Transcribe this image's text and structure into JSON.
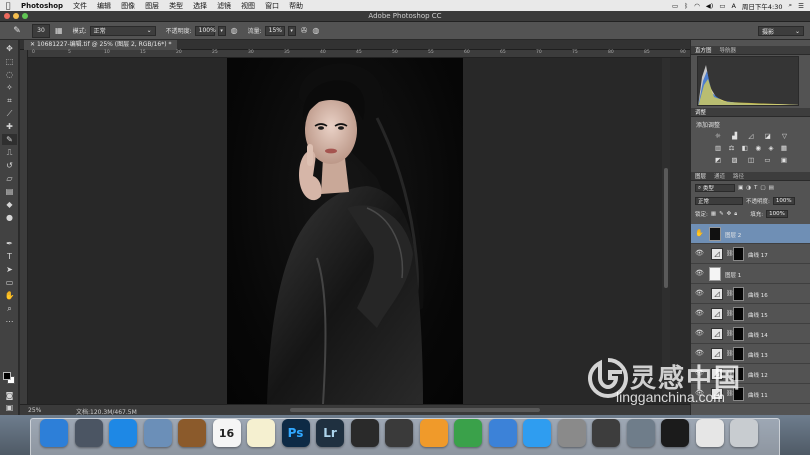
{
  "menubar": {
    "apple": "",
    "items": [
      "Photoshop",
      "文件",
      "编辑",
      "图像",
      "图层",
      "类型",
      "选择",
      "滤镜",
      "视图",
      "窗口",
      "帮助"
    ],
    "clock": "周日下午4:30"
  },
  "window": {
    "title": "Adobe Photoshop CC"
  },
  "options": {
    "mode_label": "模式:",
    "mode_value": "正常",
    "opacity_label": "不透明度:",
    "opacity_value": "100%",
    "flow_label": "流量:",
    "flow_value": "15%",
    "brush_size": "30",
    "workspace": "摄影"
  },
  "document": {
    "tab": "10681227-编辑.tif @ 25% (图层 2, RGB/16*) *",
    "ruler_marks": [
      "0",
      "5",
      "10",
      "15",
      "20",
      "25",
      "30",
      "35",
      "40",
      "45",
      "50",
      "55",
      "60",
      "65",
      "70",
      "75",
      "80",
      "85",
      "90"
    ]
  },
  "status": {
    "zoom": "25%",
    "docinfo": "文档:120.3M/467.5M"
  },
  "panels": {
    "histogram_tabs": [
      "直方图",
      "导航器"
    ],
    "adjustments_tab": "调整",
    "adjustments_title": "添加调整",
    "layers_tabs": [
      "图层",
      "通道",
      "路径"
    ],
    "kind_label": "类型",
    "blend_mode": "正常",
    "opacity_label": "不透明度:",
    "opacity_value": "100%",
    "lock_label": "锁定:",
    "fill_label": "填充:",
    "fill_value": "100%"
  },
  "layers": [
    {
      "name": "图层 2",
      "type": "pixel",
      "selected": true,
      "eye": "hand"
    },
    {
      "name": "曲线 17",
      "type": "curves",
      "selected": false,
      "eye": "eye"
    },
    {
      "name": "图层 1",
      "type": "pixel-white",
      "selected": false,
      "eye": "eye"
    },
    {
      "name": "曲线 16",
      "type": "curves",
      "selected": false,
      "eye": "eye"
    },
    {
      "name": "曲线 15",
      "type": "curves",
      "selected": false,
      "eye": "eye"
    },
    {
      "name": "曲线 14",
      "type": "curves",
      "selected": false,
      "eye": "eye"
    },
    {
      "name": "曲线 13",
      "type": "curves",
      "selected": false,
      "eye": "eye"
    },
    {
      "name": "曲线 12",
      "type": "curves",
      "selected": false,
      "eye": "eye"
    },
    {
      "name": "曲线 11",
      "type": "curves",
      "selected": false,
      "eye": "eye"
    }
  ],
  "dock": {
    "apps": [
      {
        "name": "finder-icon",
        "label": "",
        "color": "#2d7fd8"
      },
      {
        "name": "launchpad-icon",
        "label": "",
        "color": "#4b5563"
      },
      {
        "name": "safari-icon",
        "label": "",
        "color": "#1e88e5"
      },
      {
        "name": "preview-icon",
        "label": "",
        "color": "#6b8fb8"
      },
      {
        "name": "notebook-icon",
        "label": "",
        "color": "#8b5a2b"
      },
      {
        "name": "calendar-icon",
        "label": "16",
        "color": "#f5f5f5"
      },
      {
        "name": "notes-icon",
        "label": "",
        "color": "#f5f0d0"
      },
      {
        "name": "photoshop-icon",
        "label": "Ps",
        "color": "#0d2a45"
      },
      {
        "name": "lightroom-icon",
        "label": "Lr",
        "color": "#1f3040"
      },
      {
        "name": "app-dark-icon",
        "label": "",
        "color": "#2a2a2a"
      },
      {
        "name": "photo-booth-icon",
        "label": "",
        "color": "#3a3a3a"
      },
      {
        "name": "pages-icon",
        "label": "",
        "color": "#f09a2a"
      },
      {
        "name": "numbers-icon",
        "label": "",
        "color": "#3aa14a"
      },
      {
        "name": "keynote-icon",
        "label": "",
        "color": "#3c82d8"
      },
      {
        "name": "app-store-icon",
        "label": "",
        "color": "#2f9df0"
      },
      {
        "name": "system-preferences-icon",
        "label": "",
        "color": "#8a8a8a"
      },
      {
        "name": "final-cut-icon",
        "label": "",
        "color": "#3d3d3d"
      },
      {
        "name": "photos-app-icon",
        "label": "",
        "color": "#6f7d8a"
      },
      {
        "name": "qq-icon",
        "label": "",
        "color": "#1b1b1b"
      },
      {
        "name": "documents-folder-icon",
        "label": "",
        "color": "#e6e6e6"
      },
      {
        "name": "trash-icon",
        "label": "",
        "color": "#c8ccd0"
      }
    ]
  },
  "watermark": {
    "cn": "灵感中国",
    "en": "lingganchina.com"
  },
  "colors": {
    "accent": "#6f8fb5",
    "panel": "#535353",
    "canvas": "#282828"
  }
}
